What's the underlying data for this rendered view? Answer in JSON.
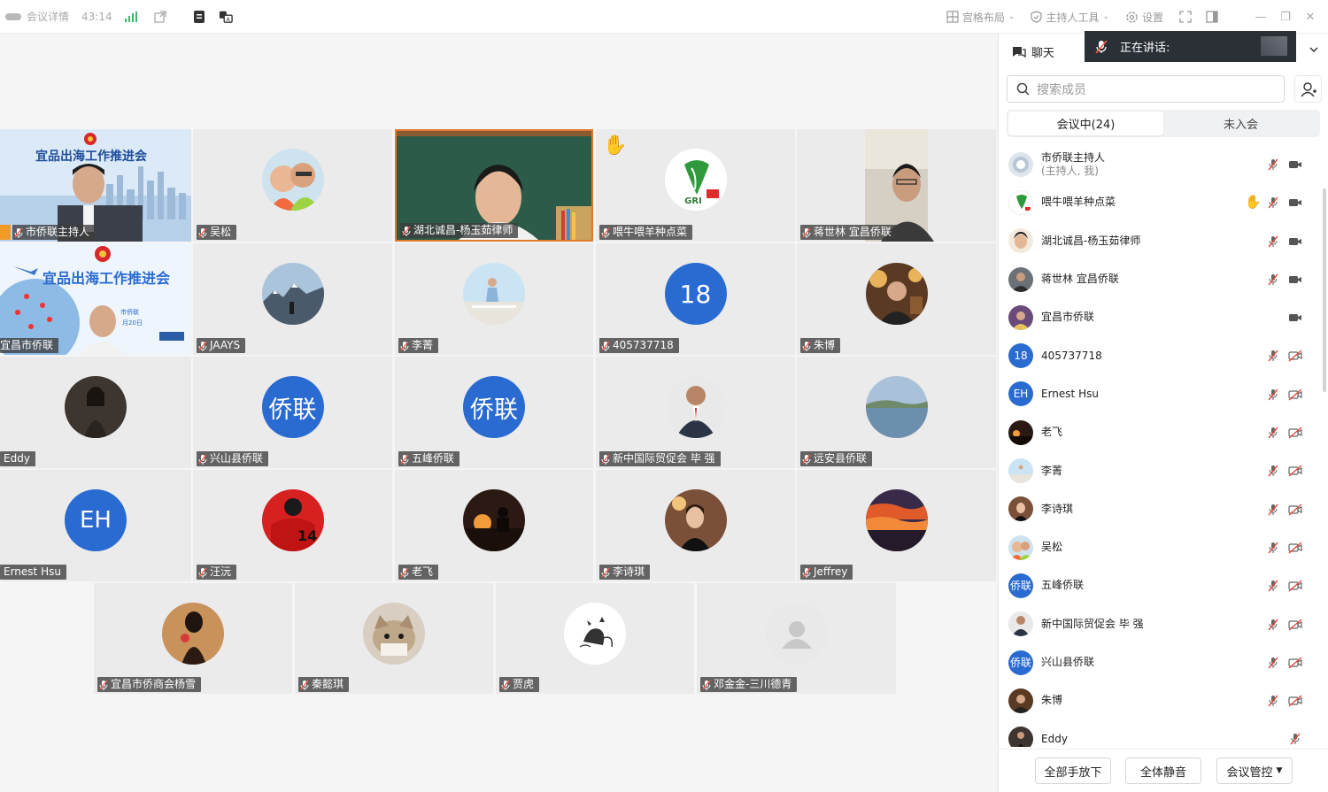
{
  "topbar": {
    "title": "会议详情",
    "timer": "43:14",
    "layout_btn": "宫格布局",
    "host_tools_btn": "主持人工具",
    "settings_btn": "设置"
  },
  "grid": {
    "tiles": [
      {
        "name": "市侨联主持人"
      },
      {
        "name": "吴松"
      },
      {
        "name": "湖北诚昌-杨玉茹律师"
      },
      {
        "name": "喂牛喂羊种点菜"
      },
      {
        "name": "蒋世林  宜昌侨联"
      },
      {
        "name": "宜昌市侨联"
      },
      {
        "name": "JAAYS"
      },
      {
        "name": "李菁"
      },
      {
        "name": "405737718",
        "avatar_text": "18"
      },
      {
        "name": "朱博"
      },
      {
        "name": "Eddy"
      },
      {
        "name": "兴山县侨联",
        "avatar_text": "侨联"
      },
      {
        "name": "五峰侨联",
        "avatar_text": "侨联"
      },
      {
        "name": "新中国际贸促会 毕 强"
      },
      {
        "name": "远安县侨联"
      },
      {
        "name": "Ernest Hsu",
        "avatar_text": "EH"
      },
      {
        "name": "汪沅"
      },
      {
        "name": "老飞"
      },
      {
        "name": "李诗琪"
      },
      {
        "name": "Jeffrey"
      },
      {
        "name": "宜昌市侨商会杨雪"
      },
      {
        "name": "秦懿琪"
      },
      {
        "name": "贾虎"
      },
      {
        "name": "邓金金-三川德青"
      }
    ],
    "banner1": "宜品出海工作推进会",
    "banner2": "宜品出海工作推进会",
    "banner2_sub1": "市侨联",
    "banner2_sub2": "月20日",
    "gri_logo": "GRI"
  },
  "panel": {
    "chat_tab": "聊天",
    "speaking_label": "正在讲话:",
    "search_placeholder": "搜索成员",
    "seg_in_meeting": "会议中(24)",
    "seg_not_joined": "未入会",
    "members": [
      {
        "name": "市侨联主持人",
        "sub": "(主持人, 我)"
      },
      {
        "name": "喂牛喂羊种点菜"
      },
      {
        "name": "湖北诚昌-杨玉茹律师"
      },
      {
        "name": "蒋世林  宜昌侨联"
      },
      {
        "name": "宜昌市侨联"
      },
      {
        "name": "405737718",
        "avatar_text": "18"
      },
      {
        "name": "Ernest Hsu",
        "avatar_text": "EH"
      },
      {
        "name": "老飞"
      },
      {
        "name": "李菁"
      },
      {
        "name": "李诗琪"
      },
      {
        "name": "吴松"
      },
      {
        "name": "五峰侨联",
        "avatar_text": "侨联"
      },
      {
        "name": "新中国际贸促会 毕 强"
      },
      {
        "name": "兴山县侨联",
        "avatar_text": "侨联"
      },
      {
        "name": "朱博"
      },
      {
        "name": "Eddy"
      }
    ],
    "btn_lower_hands": "全部手放下",
    "btn_mute_all": "全体静音",
    "btn_manage": "会议管控"
  },
  "colors": {
    "accent_blue": "#2a6bd1",
    "hand_yellow": "#f6c23a",
    "mic_muted_red": "#e04a3a"
  }
}
